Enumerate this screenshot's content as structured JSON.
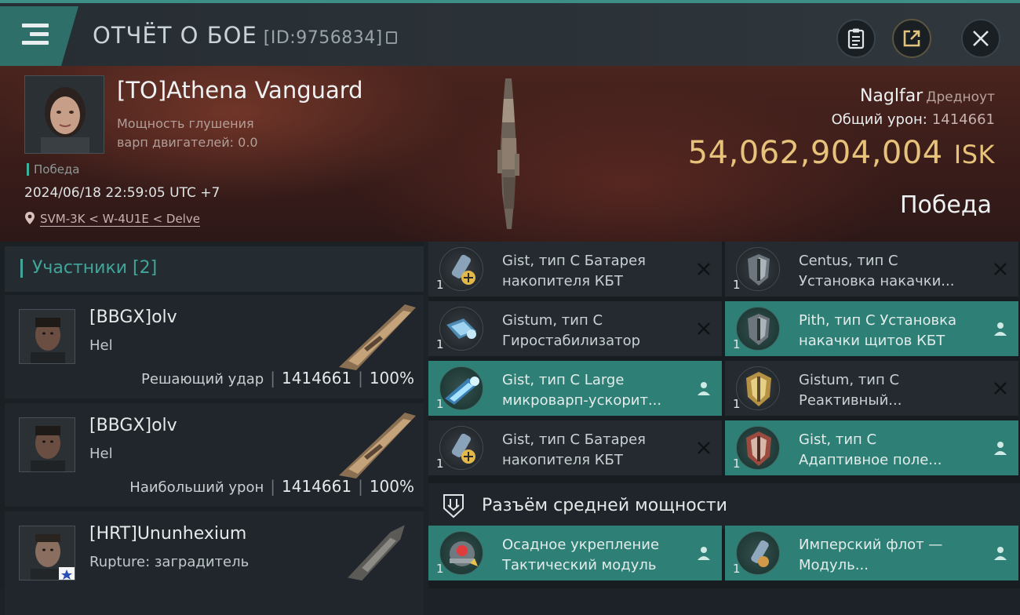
{
  "header": {
    "title": "ОТЧЁТ О БОЕ",
    "report_id": "[ID:9756834]"
  },
  "victim": {
    "name": "[TO]Athena Vanguard",
    "stat_line1": "Мощность глушения",
    "stat_line2": "варп двигателей: 0.0",
    "result_small": "Победа",
    "datetime": "2024/06/18 22:59:05 UTC +7",
    "location": "SVM-3K < W-4U1E < Delve",
    "ship_name": "Naglfar",
    "ship_class": "Дредноут",
    "total_damage_label": "Общий урон:",
    "total_damage_value": "1414661",
    "isk_value": "54,062,904,004",
    "isk_currency": "ISK",
    "result": "Победа"
  },
  "participants": {
    "header": "Участники [2]",
    "items": [
      {
        "name": "[BBGX]olv",
        "ship": "Hel",
        "role": "Решающий удар",
        "damage": "1414661",
        "percent": "100%"
      },
      {
        "name": "[BBGX]olv",
        "ship": "Hel",
        "role": "Наибольший урон",
        "damage": "1414661",
        "percent": "100%"
      },
      {
        "name": "[HRT]Ununhexium",
        "ship": "Rupture: заградитель"
      }
    ]
  },
  "modules": [
    {
      "qty": "1",
      "line1": "Gist, тип C Батарея",
      "line2": "накопителя КБТ",
      "status": "destroyed"
    },
    {
      "qty": "1",
      "line1": "Centus, тип C",
      "line2": "Установка накачки...",
      "status": "destroyed"
    },
    {
      "qty": "1",
      "line1": "Gistum, тип C",
      "line2": "Гиростабилизатор",
      "status": "destroyed"
    },
    {
      "qty": "1",
      "line1": "Pith, тип C Установка",
      "line2": "накачки щитов КБТ",
      "status": "dropped"
    },
    {
      "qty": "1",
      "line1": "Gist, тип C Large",
      "line2": "микроварп-ускорит...",
      "status": "dropped"
    },
    {
      "qty": "1",
      "line1": "Gistum, тип C",
      "line2": "Реактивный...",
      "status": "destroyed"
    },
    {
      "qty": "1",
      "line1": "Gist, тип C Батарея",
      "line2": "накопителя КБТ",
      "status": "destroyed"
    },
    {
      "qty": "1",
      "line1": "Gist, тип C",
      "line2": "Адаптивное поле...",
      "status": "dropped"
    }
  ],
  "mid_section": {
    "label": "Разъём средней мощности",
    "modules": [
      {
        "qty": "1",
        "line1": "Осадное укрепление",
        "line2": "Тактический модуль",
        "status": "dropped"
      },
      {
        "qty": "1",
        "line1": "Имперский флот —",
        "line2": "Модуль...",
        "status": "dropped"
      }
    ]
  },
  "colors": {
    "accent": "#2e7f76",
    "isk": "#e7c27a",
    "panel": "#242a2f"
  }
}
